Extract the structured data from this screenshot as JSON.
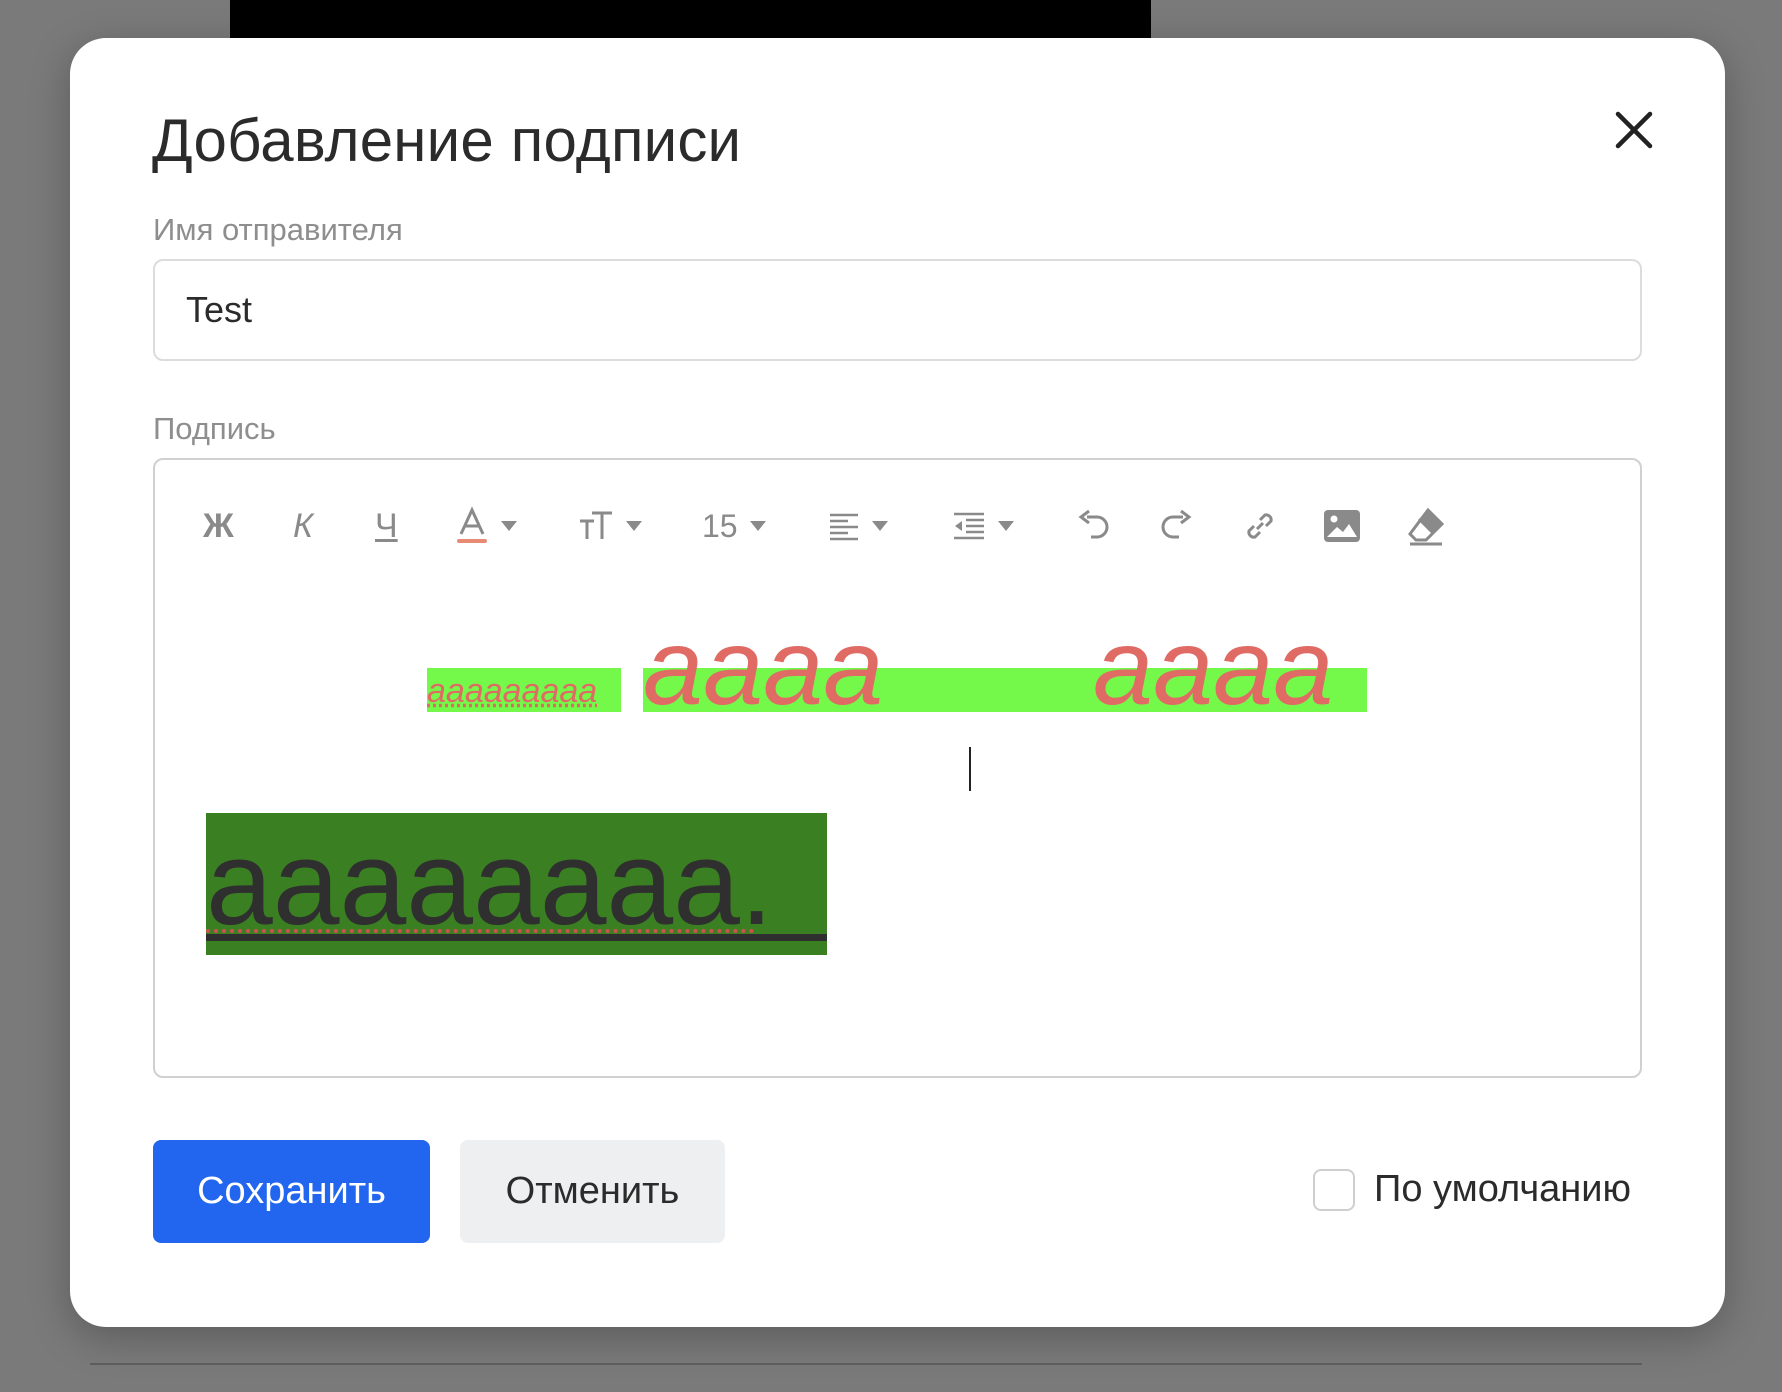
{
  "dialog": {
    "title": "Добавление подписи"
  },
  "sender": {
    "label": "Имя отправителя",
    "value": "Test"
  },
  "signature": {
    "label": "Подпись",
    "toolbar": {
      "bold": "Ж",
      "italic": "К",
      "underline": "Ч",
      "font_size": "15",
      "icons": [
        "bold-icon",
        "italic-icon",
        "underline-icon",
        "text-color-icon",
        "font-family-icon",
        "align-icon",
        "indent-icon",
        "undo-icon",
        "redo-icon",
        "link-icon",
        "image-icon",
        "eraser-icon"
      ]
    },
    "content": {
      "line1_small": "ааааааааа",
      "line1_large_a": "аааа",
      "line1_large_b": "аааа",
      "line2": "аааааааа."
    }
  },
  "actions": {
    "save": "Сохранить",
    "cancel": "Отменить",
    "default_label": "По умолчанию",
    "default_checked": false
  },
  "colors": {
    "primary": "#2265ef",
    "highlight_light": "#74f94b",
    "highlight_dark": "#3a7f22",
    "text_red": "#e06a64"
  }
}
